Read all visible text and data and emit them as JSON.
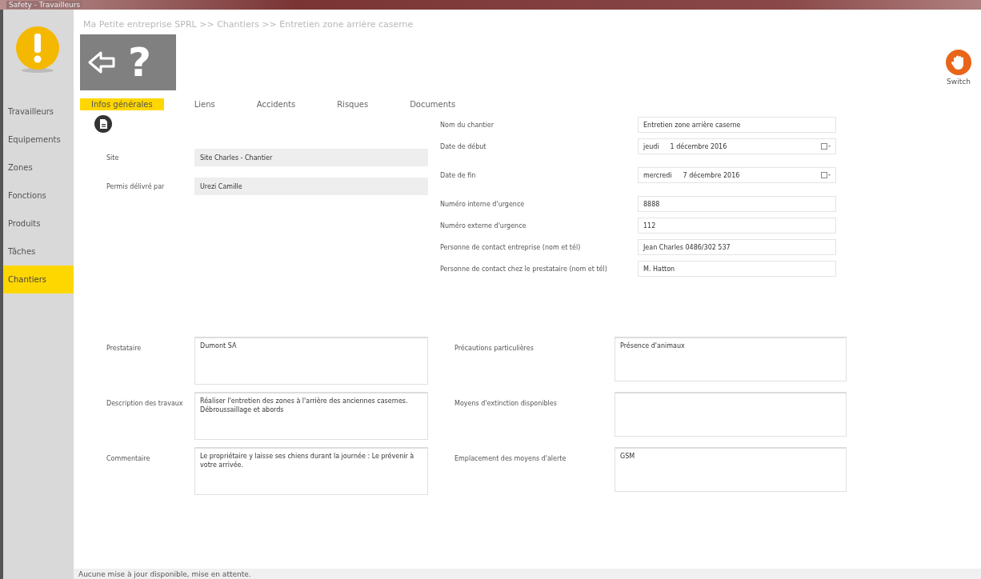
{
  "window": {
    "title": "Safety - Travailleurs"
  },
  "sidebar": {
    "items": [
      {
        "label": "Travailleurs",
        "selected": false
      },
      {
        "label": "Equipements",
        "selected": false
      },
      {
        "label": "Zones",
        "selected": false
      },
      {
        "label": "Fonctions",
        "selected": false
      },
      {
        "label": "Produits",
        "selected": false
      },
      {
        "label": "Tâches",
        "selected": false
      },
      {
        "label": "Chantiers",
        "selected": true
      }
    ]
  },
  "breadcrumb": "Ma Petite entreprise SPRL >> Chantiers >> Entretien zone arrière caserne",
  "toolbar": {
    "help_label": "?"
  },
  "switch_button": {
    "label": "Switch"
  },
  "tabs": [
    {
      "label": "Infos générales",
      "selected": true
    },
    {
      "label": "Liens",
      "selected": false
    },
    {
      "label": "Accidents",
      "selected": false
    },
    {
      "label": "Risques",
      "selected": false
    },
    {
      "label": "Documents",
      "selected": false
    }
  ],
  "left_fields": [
    {
      "label": "Site",
      "value": "Site Charles - Chantier",
      "readonly": true
    },
    {
      "label": "Permis délivré par",
      "value": "Urezi Camille",
      "readonly": true
    }
  ],
  "right_fields": [
    {
      "kind": "text",
      "label": "Nom du chantier",
      "value": "Entretien zone arrière caserne",
      "readonly": false
    },
    {
      "kind": "date",
      "label": "Date de début",
      "day": "jeudi",
      "value": "1 décembre 2016",
      "readonly": false
    },
    {
      "kind": "date",
      "label": "Date de fin",
      "day": "mercredi",
      "value": "7 décembre 2016",
      "readonly": false
    },
    {
      "kind": "text",
      "label": "Numéro interne d'urgence",
      "value": "8888",
      "readonly": false
    },
    {
      "kind": "text",
      "label": "Numéro externe d'urgence",
      "value": "112",
      "readonly": false
    },
    {
      "kind": "text",
      "label": "Personne de contact entreprise (nom et tél)",
      "value": "Jean Charles 0486/302 537",
      "readonly": false
    },
    {
      "kind": "text",
      "label": "Personne de contact chez le prestataire (nom et tél)",
      "value": "M. Hatton",
      "readonly": false
    }
  ],
  "left_notes": [
    {
      "label": "Prestataire",
      "value": "Dumont SA"
    },
    {
      "label": "Description des travaux",
      "value": "Réaliser l'entretien des zones à l'arrière des anciennes casernes. Débroussaillage et abords"
    },
    {
      "label": "Commentaire",
      "value": "Le propriétaire y laisse ses chiens durant la journée : Le prévenir à votre arrivée."
    }
  ],
  "right_notes": [
    {
      "label": "Précautions particulières",
      "value": "Présence d'animaux"
    },
    {
      "label": "Moyens d'extinction disponibles"
    },
    {
      "label": "Emplacement des moyens d'alerte",
      "value": "GSM"
    }
  ],
  "status_bar": "Aucune mise à jour disponible, mise en attente."
}
